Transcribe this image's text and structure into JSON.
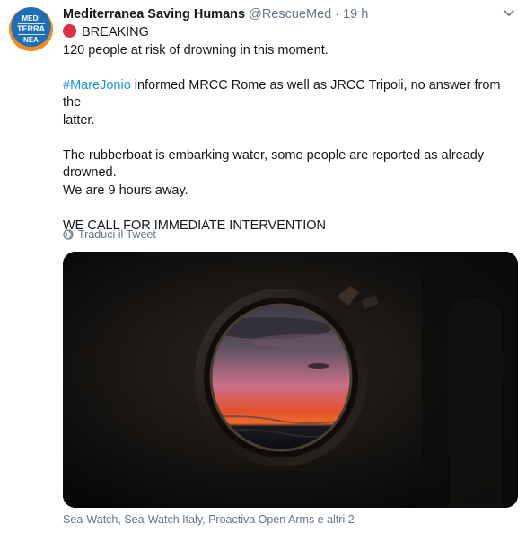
{
  "account": {
    "avatar_text": [
      "MEDI",
      "TERRA",
      "NEA"
    ],
    "avatar_ring_text": "SAVING HUMANS",
    "display_name": "Mediterranea Saving Humans",
    "handle": "@RescueMed",
    "separator": "·",
    "time": "19 h"
  },
  "tweet": {
    "breaking_label": "BREAKING",
    "line_people": "120 people at risk of drowning in this moment.",
    "hashtag": "#MareJonio",
    "line_informed": " informed  MRCC Rome as well as JRCC Tripoli, no answer from the",
    "line_latter": "latter.",
    "line_rubberboat": "The rubberboat is embarking water, some people are reported as already",
    "line_drowned": "drowned.",
    "line_away": "We are 9 hours away.",
    "line_call": "WE CALL FOR IMMEDIATE INTERVENTION"
  },
  "translate_label": "Traduci il Tweet",
  "media": {
    "alt": "Porthole view of the sea at sunset",
    "caption": "Sea-Watch, Sea-Watch Italy, Proactiva Open Arms e altri 2"
  },
  "colors": {
    "text": "#14171a",
    "muted": "#657786",
    "link": "#1b95e0",
    "breaking_dot": "#dd2e44",
    "avatar_blue": "#1c6fb8",
    "avatar_orange": "#f28c1b"
  },
  "icons": [
    "chevron-down-icon",
    "globe-icon",
    "red-circle-icon"
  ]
}
